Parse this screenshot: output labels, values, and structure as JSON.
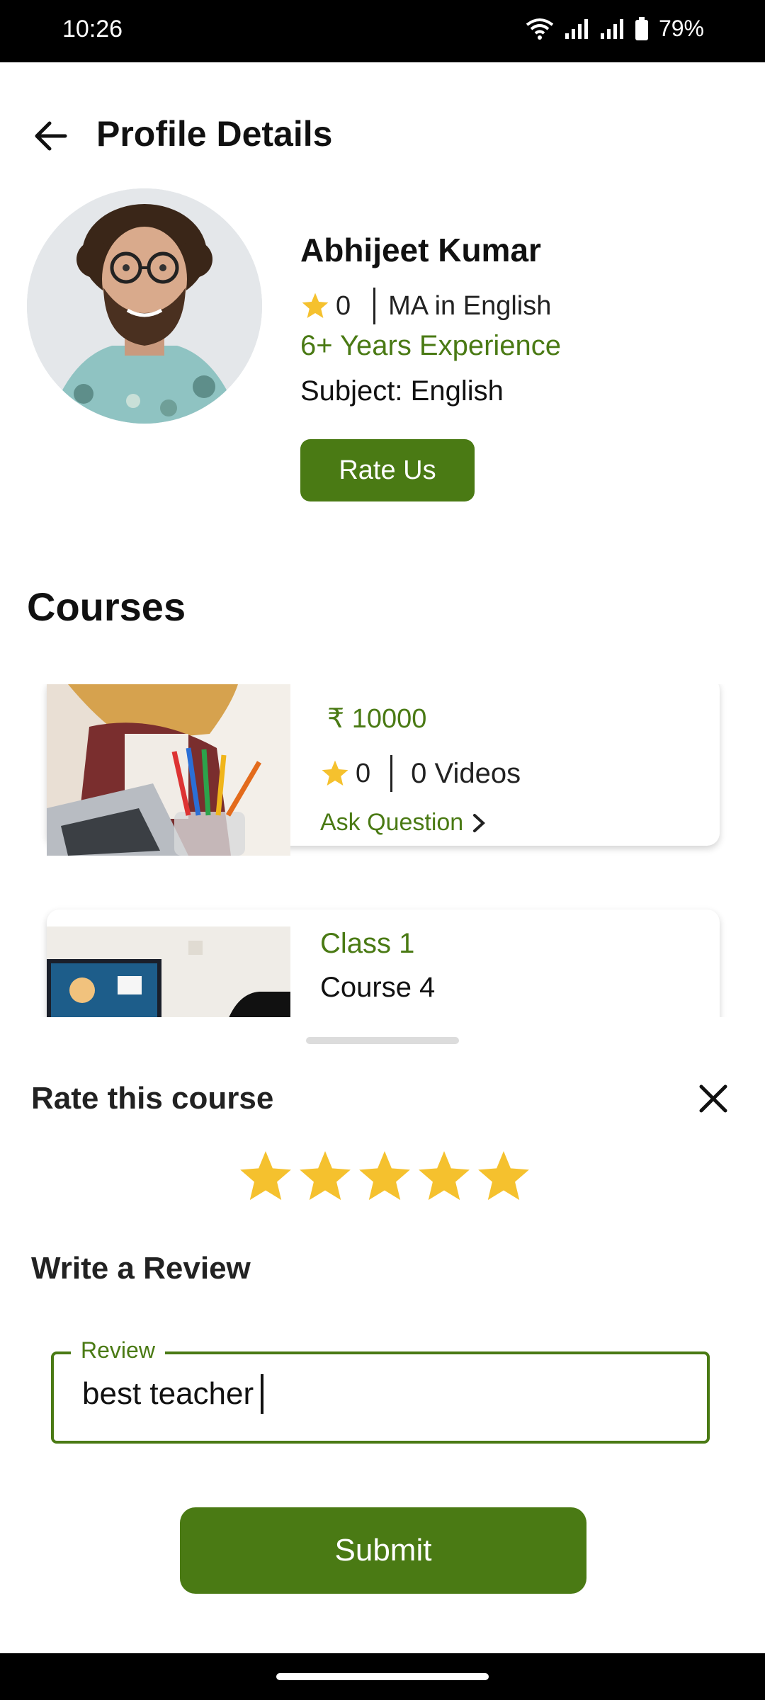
{
  "status_bar": {
    "time": "10:26",
    "battery": "79%"
  },
  "header": {
    "title": "Profile Details"
  },
  "profile": {
    "name": "Abhijeet Kumar",
    "rating": "0",
    "qualification": "MA in English",
    "experience": "6+ Years Experience",
    "subject": "Subject: English",
    "rate_button": "Rate Us"
  },
  "courses": {
    "title": "Courses",
    "items": [
      {
        "price": "₹ 10000",
        "rating": "0",
        "videos": "0 Videos",
        "ask": "Ask Question"
      },
      {
        "class_label": "Class 1",
        "name": "Course 4"
      }
    ]
  },
  "rating_sheet": {
    "title": "Rate this course",
    "stars_selected": 5,
    "stars_total": 5,
    "review_heading": "Write a Review",
    "review_label": "Review",
    "review_value": "best teacher",
    "submit_label": "Submit"
  },
  "colors": {
    "accent": "#4a7a14",
    "star": "#f5c12e"
  }
}
